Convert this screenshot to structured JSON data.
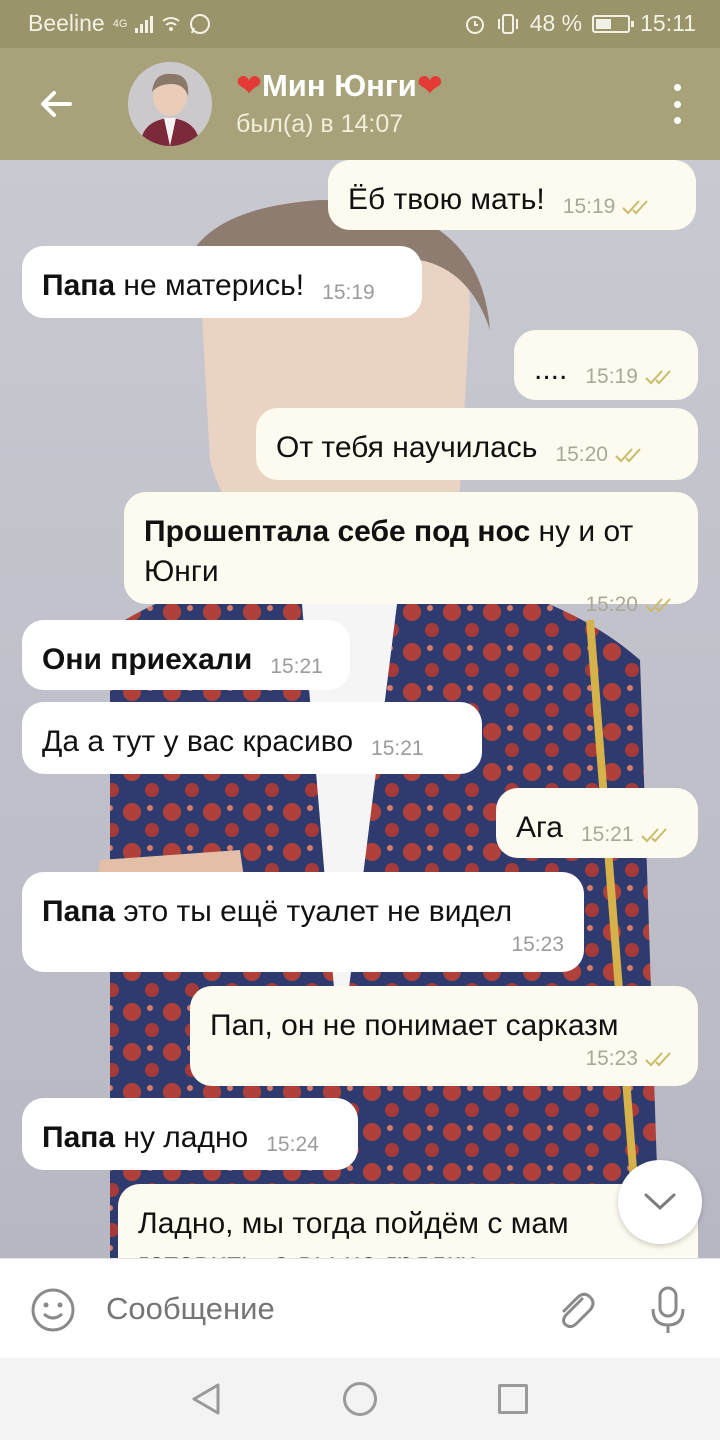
{
  "status_bar": {
    "carrier": "Beeline",
    "network": "4G",
    "battery": "48 %",
    "battery_level": 0.48,
    "time": "15:11"
  },
  "header": {
    "back_icon": "arrow-left-icon",
    "contact_name": "Мин Юнги",
    "heart_left": "❤",
    "heart_right": "❤",
    "last_seen": "был(а) в 14:07",
    "menu_icon": "vertical-dots-icon"
  },
  "messages": [
    {
      "dir": "out",
      "bold": "",
      "text": "Ёб твою мать!",
      "time": "15:19",
      "read": true
    },
    {
      "dir": "in",
      "bold": "Папа",
      "text": " не матерись!",
      "time": "15:19"
    },
    {
      "dir": "out",
      "bold": "",
      "text": "....",
      "time": "15:19",
      "read": true
    },
    {
      "dir": "out",
      "bold": "",
      "text": "От тебя научилась",
      "time": "15:20",
      "read": true
    },
    {
      "dir": "out",
      "bold": "Прошептала себе под нос",
      "text": " ну и от Юнги",
      "time": "15:20",
      "read": true
    },
    {
      "dir": "in",
      "bold": "Они приехали",
      "text": "",
      "time": "15:21"
    },
    {
      "dir": "in",
      "bold": "",
      "text": "Да а тут у вас красиво",
      "time": "15:21"
    },
    {
      "dir": "out",
      "bold": "",
      "text": "Ага",
      "time": "15:21",
      "read": true
    },
    {
      "dir": "in",
      "bold": "Папа",
      "text": " это ты ещё туалет не видел",
      "time": "15:23"
    },
    {
      "dir": "out",
      "bold": "",
      "text": "Пап, он не понимает сарказм",
      "time": "15:23",
      "read": true
    },
    {
      "dir": "in",
      "bold": "Папа",
      "text": " ну ладно",
      "time": "15:24"
    },
    {
      "dir": "out",
      "bold": "",
      "text": "Ладно, мы тогда пойдём с мам",
      "text2": "готовить, а вы на грядки",
      "time": "",
      "read": false
    }
  ],
  "composer": {
    "placeholder": "Сообщение",
    "emoji_icon": "smiley-icon",
    "attach_icon": "paperclip-icon",
    "mic_icon": "microphone-icon"
  },
  "colors": {
    "header": "#a8a27a",
    "status_bar": "#9a946a",
    "outgoing_bubble": "#fdfbef",
    "incoming_bubble": "#ffffff",
    "read_ticks": "#c9bb6a"
  }
}
